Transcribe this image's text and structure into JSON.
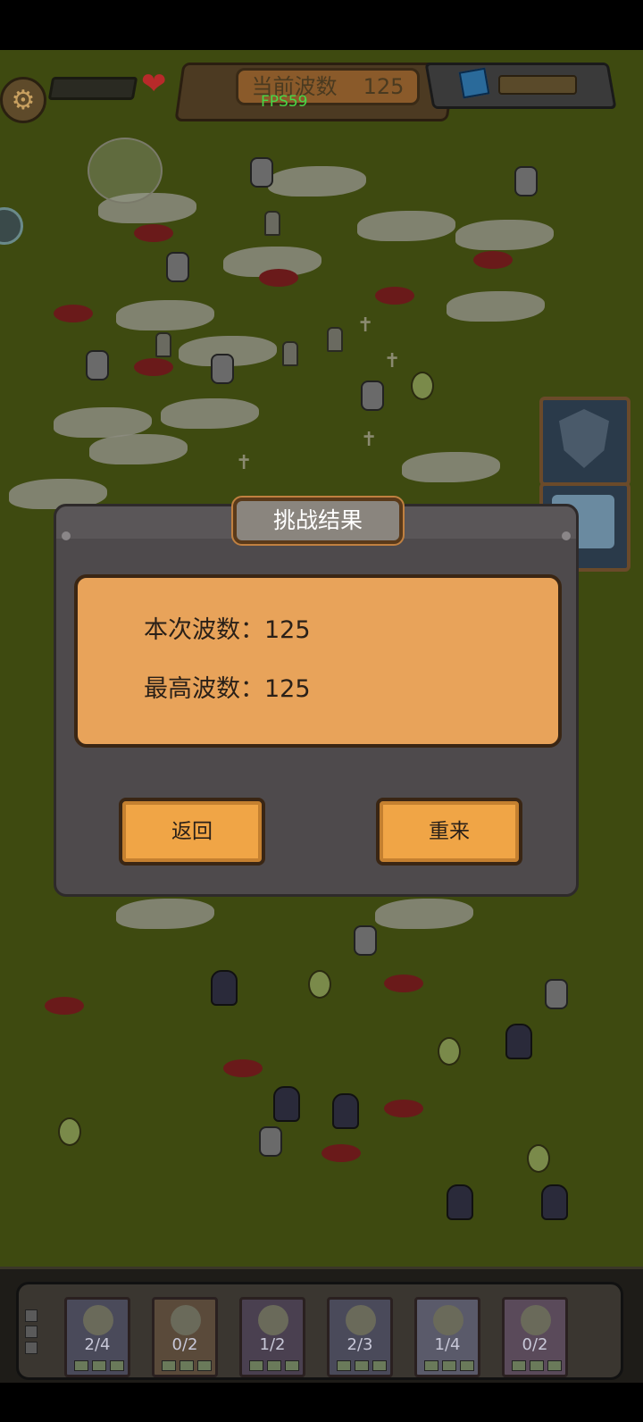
{
  "hud": {
    "wave_title": "当前波数",
    "wave_value": "125",
    "fps": "FPS59"
  },
  "dialog": {
    "title": "挑战结果",
    "current_wave_label": "本次波数：125",
    "best_wave_label": "最高波数：125",
    "back_button": "返回",
    "retry_button": "重来"
  },
  "units": [
    {
      "count": "2/4"
    },
    {
      "count": "0/2"
    },
    {
      "count": "1/2"
    },
    {
      "count": "2/3"
    },
    {
      "count": "1/4"
    },
    {
      "count": "0/2"
    }
  ],
  "colors": {
    "field": "#3e4a10",
    "dialog_bg": "#4e4a4c",
    "panel": "#e8a35a",
    "button": "#f0a546",
    "fps": "#46d846"
  }
}
